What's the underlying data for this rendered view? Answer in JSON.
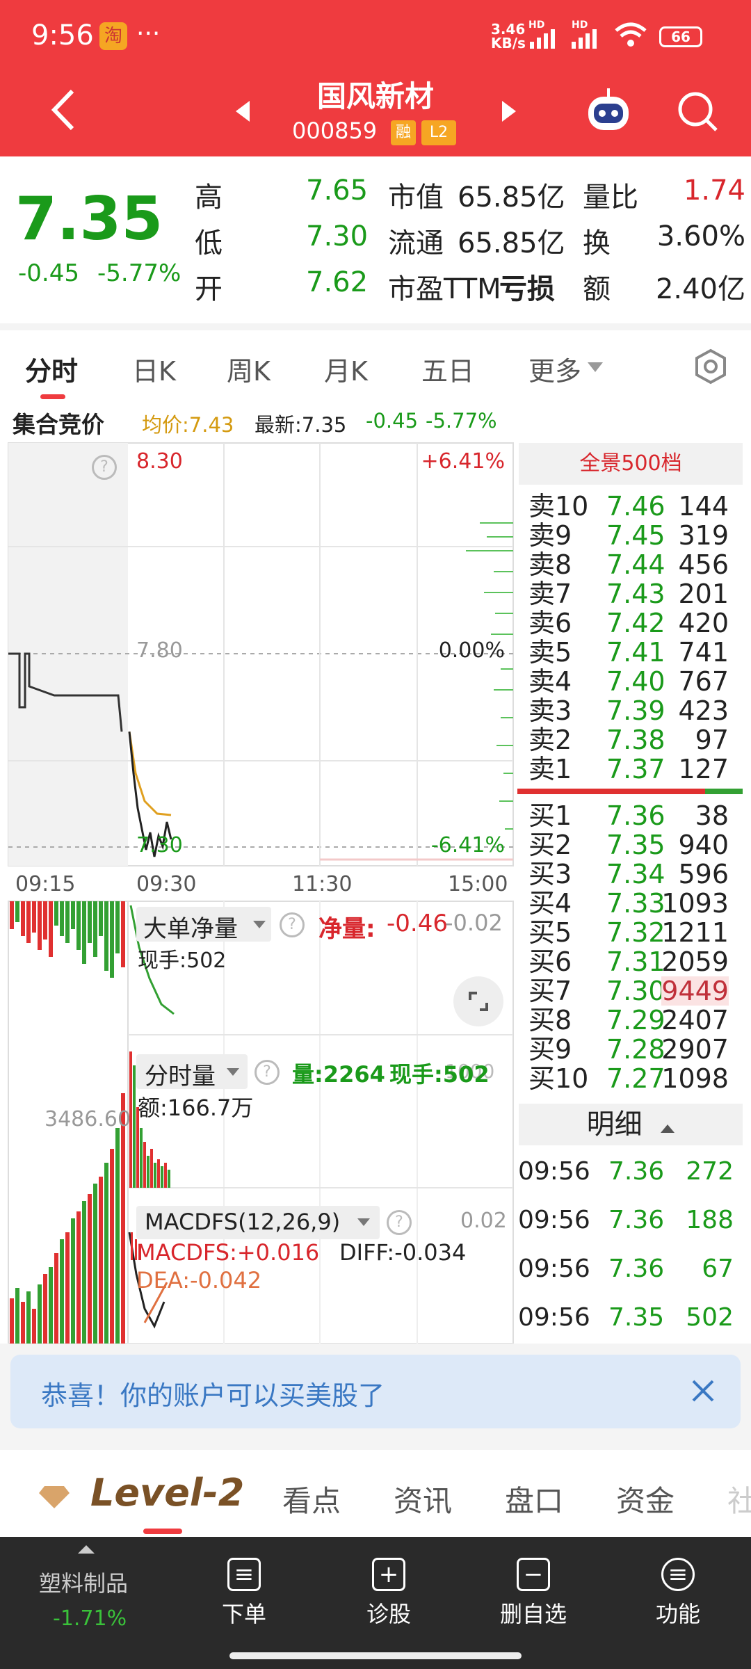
{
  "status_bar": {
    "time": "9:56",
    "app_badge": "淘",
    "dots": "···",
    "speed_top": "3.46",
    "speed_bottom": "KB/s",
    "hd1": "HD",
    "hd2": "HD",
    "battery": "66"
  },
  "header": {
    "title": "国风新材",
    "code": "000859",
    "tag_rong": "融",
    "tag_l2": "L2"
  },
  "quote": {
    "price": "7.35",
    "change": "-0.45",
    "change_pct": "-5.77%",
    "high_label": "高",
    "high": "7.65",
    "low_label": "低",
    "low": "7.30",
    "open_label": "开",
    "open": "7.62",
    "mktcap_label": "市值",
    "mktcap": "65.85亿",
    "float_label": "流通",
    "float": "65.85亿",
    "pe_label": "市盈TTM",
    "pe": "亏损",
    "vol_ratio_label": "量比",
    "vol_ratio": "1.74",
    "turnover_label": "换",
    "turnover": "3.60%",
    "amount_label": "额",
    "amount": "2.40亿"
  },
  "tabs": [
    "分时",
    "日K",
    "周K",
    "月K",
    "五日",
    "更多"
  ],
  "subheader": {
    "auction": "集合竞价",
    "avg": "均价:7.43",
    "latest": "最新:7.35",
    "chg": "-0.45",
    "pct": "-5.77%"
  },
  "intraday": {
    "price_top": "8.30",
    "price_mid": "7.80",
    "price_bot": "7.30",
    "pct_top": "+6.41%",
    "pct_mid": "0.00%",
    "pct_bot": "-6.41%",
    "times": [
      "09:15",
      "09:30",
      "11:30",
      "15:00"
    ]
  },
  "panel_bigorder": {
    "label": "大单净量",
    "net_label": "净量:",
    "net": "-0.46",
    "right": "-0.02",
    "hand": "现手:502"
  },
  "panel_volume": {
    "label": "分时量",
    "vol": "量:2264",
    "hand": "现手:502",
    "amount": "额:166.7万",
    "left_val": "3486.60",
    "right_val": "1000"
  },
  "panel_macd": {
    "label": "MACDFS(12,26,9)",
    "macd": "MACDFS:+0.016",
    "diff": "DIFF:-0.034",
    "dea": "DEA:-0.042",
    "right": "0.02"
  },
  "orderbook": {
    "title": "全景500档",
    "sells": [
      {
        "label": "卖10",
        "price": "7.46",
        "vol": "144"
      },
      {
        "label": "卖9",
        "price": "7.45",
        "vol": "319"
      },
      {
        "label": "卖8",
        "price": "7.44",
        "vol": "456"
      },
      {
        "label": "卖7",
        "price": "7.43",
        "vol": "201"
      },
      {
        "label": "卖6",
        "price": "7.42",
        "vol": "420"
      },
      {
        "label": "卖5",
        "price": "7.41",
        "vol": "741"
      },
      {
        "label": "卖4",
        "price": "7.40",
        "vol": "767"
      },
      {
        "label": "卖3",
        "price": "7.39",
        "vol": "423"
      },
      {
        "label": "卖2",
        "price": "7.38",
        "vol": "97"
      },
      {
        "label": "卖1",
        "price": "7.37",
        "vol": "127"
      }
    ],
    "buys": [
      {
        "label": "买1",
        "price": "7.36",
        "vol": "38"
      },
      {
        "label": "买2",
        "price": "7.35",
        "vol": "940"
      },
      {
        "label": "买3",
        "price": "7.34",
        "vol": "596"
      },
      {
        "label": "买4",
        "price": "7.33",
        "vol": "1093"
      },
      {
        "label": "买5",
        "price": "7.32",
        "vol": "1211"
      },
      {
        "label": "买6",
        "price": "7.31",
        "vol": "2059"
      },
      {
        "label": "买7",
        "price": "7.30",
        "vol": "9449"
      },
      {
        "label": "买8",
        "price": "7.29",
        "vol": "2407"
      },
      {
        "label": "买9",
        "price": "7.28",
        "vol": "2907"
      },
      {
        "label": "买10",
        "price": "7.27",
        "vol": "1098"
      }
    ],
    "detail_title": "明细",
    "details": [
      {
        "time": "09:56",
        "price": "7.36",
        "vol": "272"
      },
      {
        "time": "09:56",
        "price": "7.36",
        "vol": "188"
      },
      {
        "time": "09:56",
        "price": "7.36",
        "vol": "67"
      },
      {
        "time": "09:56",
        "price": "7.35",
        "vol": "502"
      }
    ]
  },
  "banner": {
    "text": "恭喜！你的账户可以买美股了"
  },
  "bottom_tabs": [
    "Level-2",
    "看点",
    "资讯",
    "盘口",
    "资金",
    "社"
  ],
  "nav": {
    "sector_name": "塑料制品",
    "sector_pct": "-1.71%",
    "items": [
      "下单",
      "诊股",
      "删自选",
      "功能"
    ]
  },
  "colors": {
    "red": "#ef3b3f",
    "green": "#1a9a1a",
    "down_red": "#d8262c",
    "avg_line": "#e0a020"
  }
}
